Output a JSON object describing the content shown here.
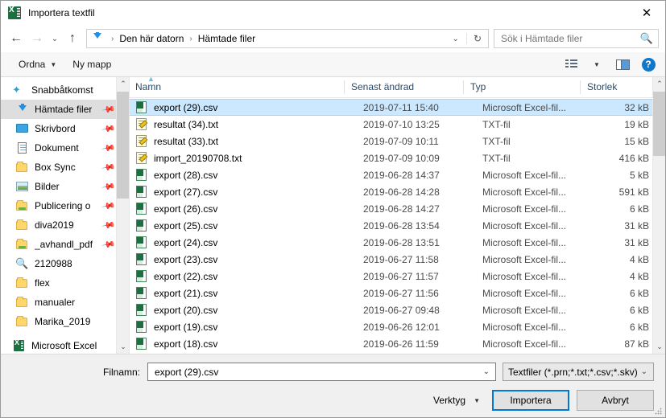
{
  "window": {
    "title": "Importera textfil",
    "app_icon": "excel-icon",
    "close_label": "✕"
  },
  "nav": {
    "back_icon": "←",
    "forward_icon": "→",
    "recent_icon": "⌄",
    "up_icon": "↑",
    "breadcrumb": [
      "Den här datorn",
      "Hämtade filer"
    ],
    "breadcrumb_icon": "downloads-arrow-icon",
    "separator": "›",
    "dropdown_icon": "⌄",
    "refresh_icon": "↻"
  },
  "search": {
    "placeholder": "Sök i Hämtade filer",
    "value": "",
    "icon": "search-icon"
  },
  "toolbar": {
    "organize_label": "Ordna",
    "organize_caret": "▼",
    "new_folder_label": "Ny mapp",
    "view_icon": "list-view-icon",
    "view_caret": "▼",
    "preview_icon": "preview-pane-icon",
    "help_icon": "?"
  },
  "sidebar": {
    "scroll_up": "⌃",
    "scroll_down": "⌄",
    "items": [
      {
        "label": "Snabbåtkomst",
        "icon": "star-icon",
        "level": 0,
        "pin": false,
        "selected": false
      },
      {
        "label": "Hämtade filer",
        "icon": "downloads-icon",
        "level": 1,
        "pin": true,
        "selected": true
      },
      {
        "label": "Skrivbord",
        "icon": "desktop-icon",
        "level": 1,
        "pin": true,
        "selected": false
      },
      {
        "label": "Dokument",
        "icon": "document-icon",
        "level": 1,
        "pin": true,
        "selected": false
      },
      {
        "label": "Box Sync",
        "icon": "folder-icon",
        "level": 1,
        "pin": true,
        "selected": false
      },
      {
        "label": "Bilder",
        "icon": "pictures-icon",
        "level": 1,
        "pin": true,
        "selected": false
      },
      {
        "label": "Publicering o",
        "icon": "shared-folder-icon",
        "level": 1,
        "pin": true,
        "selected": false
      },
      {
        "label": "diva2019",
        "icon": "folder-icon",
        "level": 1,
        "pin": true,
        "selected": false
      },
      {
        "label": "_avhandl_pdf",
        "icon": "shared-folder-icon",
        "level": 1,
        "pin": true,
        "selected": false
      },
      {
        "label": "2120988",
        "icon": "saved-search-icon",
        "level": 1,
        "pin": false,
        "selected": false
      },
      {
        "label": "flex",
        "icon": "folder-icon",
        "level": 1,
        "pin": false,
        "selected": false
      },
      {
        "label": "manualer",
        "icon": "folder-icon",
        "level": 1,
        "pin": false,
        "selected": false
      },
      {
        "label": "Marika_2019",
        "icon": "folder-icon",
        "level": 1,
        "pin": false,
        "selected": false
      },
      {
        "label": "Microsoft Excel",
        "icon": "excel-icon",
        "level": 0,
        "pin": false,
        "selected": false
      }
    ]
  },
  "filelist": {
    "sort_indicator": "▲",
    "columns": [
      "Namn",
      "Senast ändrad",
      "Typ",
      "Storlek"
    ],
    "scroll_up": "⌃",
    "scroll_down": "⌄",
    "rows": [
      {
        "name": "export (29).csv",
        "modified": "2019-07-11 15:40",
        "type": "Microsoft Excel-fil...",
        "size": "32 kB",
        "icon": "csv-file-icon",
        "selected": true
      },
      {
        "name": "resultat (34).txt",
        "modified": "2019-07-10 13:25",
        "type": "TXT-fil",
        "size": "19 kB",
        "icon": "txt-file-icon",
        "selected": false
      },
      {
        "name": "resultat (33).txt",
        "modified": "2019-07-09 10:11",
        "type": "TXT-fil",
        "size": "15 kB",
        "icon": "txt-file-icon",
        "selected": false
      },
      {
        "name": "import_20190708.txt",
        "modified": "2019-07-09 10:09",
        "type": "TXT-fil",
        "size": "416 kB",
        "icon": "txt-file-icon",
        "selected": false
      },
      {
        "name": "export (28).csv",
        "modified": "2019-06-28 14:37",
        "type": "Microsoft Excel-fil...",
        "size": "5 kB",
        "icon": "csv-file-icon",
        "selected": false
      },
      {
        "name": "export (27).csv",
        "modified": "2019-06-28 14:28",
        "type": "Microsoft Excel-fil...",
        "size": "591 kB",
        "icon": "csv-file-icon",
        "selected": false
      },
      {
        "name": "export (26).csv",
        "modified": "2019-06-28 14:27",
        "type": "Microsoft Excel-fil...",
        "size": "6 kB",
        "icon": "csv-file-icon",
        "selected": false
      },
      {
        "name": "export (25).csv",
        "modified": "2019-06-28 13:54",
        "type": "Microsoft Excel-fil...",
        "size": "31 kB",
        "icon": "csv-file-icon",
        "selected": false
      },
      {
        "name": "export (24).csv",
        "modified": "2019-06-28 13:51",
        "type": "Microsoft Excel-fil...",
        "size": "31 kB",
        "icon": "csv-file-icon",
        "selected": false
      },
      {
        "name": "export (23).csv",
        "modified": "2019-06-27 11:58",
        "type": "Microsoft Excel-fil...",
        "size": "4 kB",
        "icon": "csv-file-icon",
        "selected": false
      },
      {
        "name": "export (22).csv",
        "modified": "2019-06-27 11:57",
        "type": "Microsoft Excel-fil...",
        "size": "4 kB",
        "icon": "csv-file-icon",
        "selected": false
      },
      {
        "name": "export (21).csv",
        "modified": "2019-06-27 11:56",
        "type": "Microsoft Excel-fil...",
        "size": "6 kB",
        "icon": "csv-file-icon",
        "selected": false
      },
      {
        "name": "export (20).csv",
        "modified": "2019-06-27 09:48",
        "type": "Microsoft Excel-fil...",
        "size": "6 kB",
        "icon": "csv-file-icon",
        "selected": false
      },
      {
        "name": "export (19).csv",
        "modified": "2019-06-26 12:01",
        "type": "Microsoft Excel-fil...",
        "size": "6 kB",
        "icon": "csv-file-icon",
        "selected": false
      },
      {
        "name": "export (18).csv",
        "modified": "2019-06-26 11:59",
        "type": "Microsoft Excel-fil...",
        "size": "87 kB",
        "icon": "csv-file-icon",
        "selected": false
      }
    ]
  },
  "footer": {
    "filename_label": "Filnamn:",
    "filename_value": "export (29).csv",
    "filename_chevron": "⌄",
    "filter_value": "Textfiler (*.prn;*.txt;*.csv;*.skv)",
    "filter_chevron": "⌄",
    "tools_label": "Verktyg",
    "tools_caret": "▼",
    "import_label": "Importera",
    "cancel_label": "Avbryt"
  },
  "colors": {
    "accent": "#0078d7",
    "selection": "#cce8ff",
    "excel_green": "#1d6f42",
    "downloads_blue": "#1e90e8"
  }
}
